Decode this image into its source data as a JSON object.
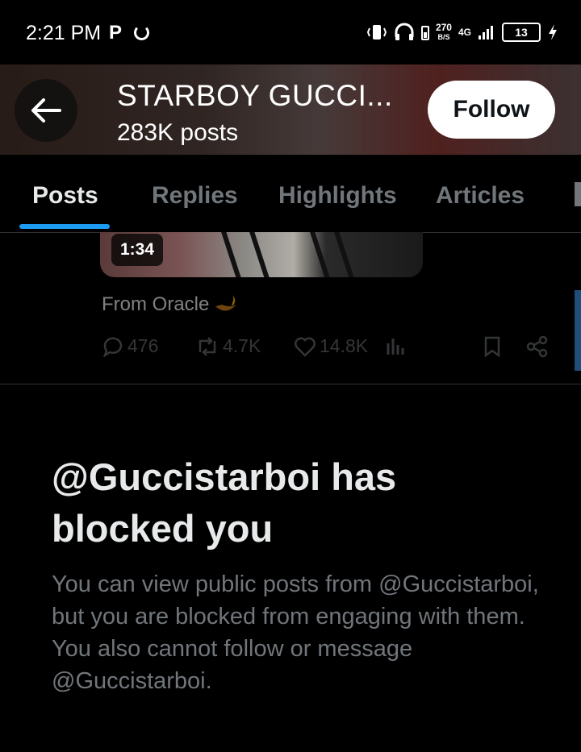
{
  "status_bar": {
    "time": "2:21 PM",
    "app_icon": "P",
    "speed_value": "270",
    "speed_unit": "B/S",
    "network": "4G",
    "battery": "13"
  },
  "header": {
    "name": "STARBOY GUCCI...",
    "post_count": "283K posts",
    "follow_label": "Follow"
  },
  "tabs": [
    "Posts",
    "Replies",
    "Highlights",
    "Articles"
  ],
  "post": {
    "duration": "1:34",
    "text": "From Oracle",
    "replies": "476",
    "reposts": "4.7K",
    "likes": "14.8K"
  },
  "blocked": {
    "title": "@Guccistarboi has blocked you",
    "description": "You can view public posts from @Guccistarboi, but you are blocked from engaging with them. You also cannot follow or message @Guccistarboi."
  },
  "colors": {
    "accent": "#1d9bf0",
    "background": "#000000",
    "muted_text": "#71767b"
  }
}
